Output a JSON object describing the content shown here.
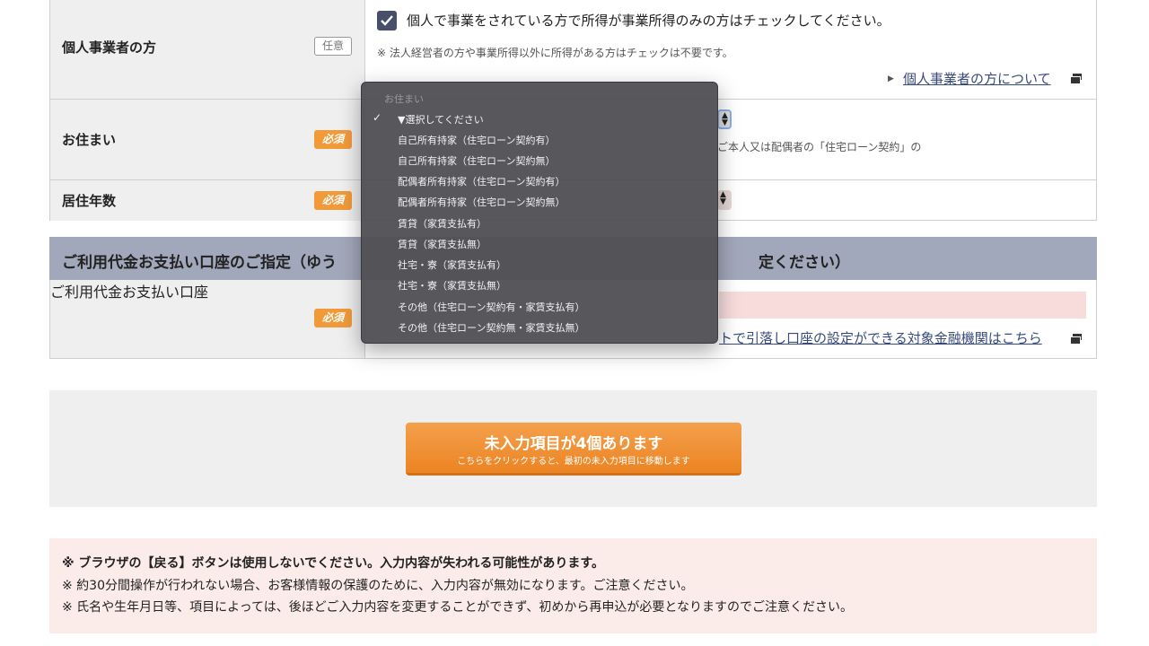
{
  "form": {
    "individual": {
      "label": "個人事業者の方",
      "badge": "任意",
      "checkbox_label": "個人で事業をされている方で所得が事業所得のみの方はチェックしてください。",
      "note": "※ 法人経営者の方や事業所得以外に所得がある方はチェックは不要です。",
      "link": "個人事業者の方について"
    },
    "residence": {
      "label": "お住まい",
      "badge": "必須",
      "note_partial": "ご本人又は配偶者の「住宅ローン契約」の"
    },
    "years": {
      "label": "居住年数",
      "badge": "必須"
    }
  },
  "section": {
    "title_left": "ご利用代金お支払い口座のご指定（ゆう",
    "title_right": "定ください）",
    "account_label": "ご利用代金お支払い口座",
    "account_badge": "必須",
    "account_link_partial": "トで引落し口座の設定ができる対象金融機関はこちら"
  },
  "submit": {
    "main_label": "未入力項目が4個あります",
    "sub_label": "こちらをクリックすると、最初の未入力項目に移動します"
  },
  "warnings": {
    "line1": "※ ブラウザの【戻る】ボタンは使用しないでください。入力内容が失われる可能性があります。",
    "line2": "※ 約30分間操作が行われない場合、お客様情報の保護のために、入力内容が無効になります。ご注意ください。",
    "line3": "※ 氏名や生年月日等、項目によっては、後ほどご入力内容を変更することができず、初めから再申込が必要となりますのでご注意ください。"
  },
  "dropdown": {
    "header": "お住まい",
    "options": [
      {
        "label": "▼選択してください",
        "checked": "✓"
      },
      {
        "label": "自己所有持家（住宅ローン契約有）",
        "checked": ""
      },
      {
        "label": "自己所有持家（住宅ローン契約無）",
        "checked": ""
      },
      {
        "label": "配偶者所有持家（住宅ローン契約有）",
        "checked": ""
      },
      {
        "label": "配偶者所有持家（住宅ローン契約無）",
        "checked": ""
      },
      {
        "label": "賃貸（家賃支払有）",
        "checked": ""
      },
      {
        "label": "賃貸（家賃支払無）",
        "checked": ""
      },
      {
        "label": "社宅・寮（家賃支払有）",
        "checked": ""
      },
      {
        "label": "社宅・寮（家賃支払無）",
        "checked": ""
      },
      {
        "label": "その他（住宅ローン契約有・家賃支払有）",
        "checked": ""
      },
      {
        "label": "その他（住宅ローン契約無・家賃支払無）",
        "checked": ""
      }
    ]
  },
  "colors": {
    "accent_orange": "#f19a3a",
    "section_header": "#a2a8bb",
    "warning_bg": "#fbecea"
  }
}
